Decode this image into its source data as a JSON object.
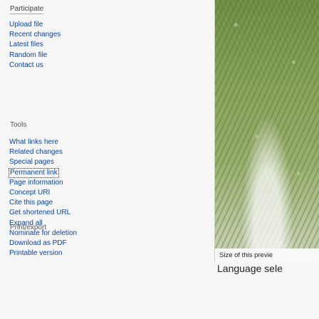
{
  "sidebar": {
    "participate": {
      "heading": "Participate",
      "items": [
        {
          "label": "Upload file"
        },
        {
          "label": "Recent changes"
        },
        {
          "label": "Latest files"
        },
        {
          "label": "Random file"
        },
        {
          "label": "Contact us"
        }
      ]
    },
    "tools": {
      "heading": "Tools",
      "items": [
        {
          "label": "What links here"
        },
        {
          "label": "Related changes"
        },
        {
          "label": "Special pages"
        },
        {
          "label": "Permanent link"
        },
        {
          "label": "Page information"
        },
        {
          "label": "Concept URI"
        },
        {
          "label": "Cite this page"
        },
        {
          "label": "Get shortened URL"
        },
        {
          "label": "Expand all"
        },
        {
          "label": "Nominate for deletion"
        }
      ]
    },
    "print": {
      "heading": "Print/export",
      "items": [
        {
          "label": "Download as PDF"
        },
        {
          "label": "Printable version"
        }
      ]
    }
  },
  "content": {
    "caption": "Size of this previe",
    "language": "Language sele"
  }
}
